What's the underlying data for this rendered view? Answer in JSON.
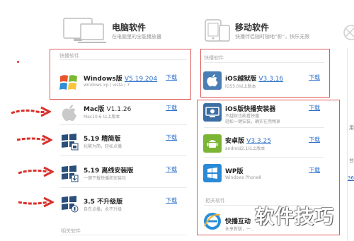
{
  "left": {
    "title": "电脑软件",
    "subtitle": "在电脑里的全能播放器",
    "featured_label": "快播软件",
    "featured": {
      "name": "Windows版",
      "version": "V5.19.204",
      "sub": "windows xp / vista / 7",
      "download": "下载"
    },
    "items": [
      {
        "name": "Mac版",
        "version": "V1.1.26",
        "sub": "Mac10.6 以上版本",
        "download": "下载"
      },
      {
        "name": "5.19 精简版",
        "version": "",
        "sub": "化繁为简，轻松点播",
        "download": "下载"
      },
      {
        "name": "5.19 离线安装版",
        "version": "",
        "sub": "一键下载快播和安装包",
        "download": "下载"
      },
      {
        "name": "3.5 不升级版",
        "version": "",
        "sub": "自在点播，永不升级",
        "download": "下载"
      }
    ],
    "related_label": "相关软件"
  },
  "right": {
    "title": "移动软件",
    "subtitle": "快播伴侣随时随地“影”，快乐无限",
    "featured_label": "快播软件",
    "featured": {
      "name": "iOS越狱版",
      "version": "V3.3.16",
      "sub": "iOS5.0以上版本",
      "download": "下载"
    },
    "items": [
      {
        "name": "iOS版快播安装器",
        "version": "",
        "sub1": "不越狱也能看快播",
        "sub2": "轻松一键安装，确实在用畅享",
        "download": "下载"
      },
      {
        "name": "安卓版",
        "version": "V3.3.25",
        "sub1": "android2.1以上版本",
        "sub2": "",
        "download": "下载"
      },
      {
        "name": "WP版",
        "version": "",
        "sub1": "Windows Phone8",
        "sub2": "",
        "download": "下载"
      }
    ],
    "related_label": "相关软件",
    "related_item": {
      "name": "快播互动",
      "sub": "永享新版，一..."
    }
  },
  "edge": {
    "chars": [
      "用",
      "台",
      "36"
    ]
  },
  "watermark": "软件技巧",
  "colors": {
    "accent": "#2a6fc9",
    "annotation": "#d9312b"
  }
}
